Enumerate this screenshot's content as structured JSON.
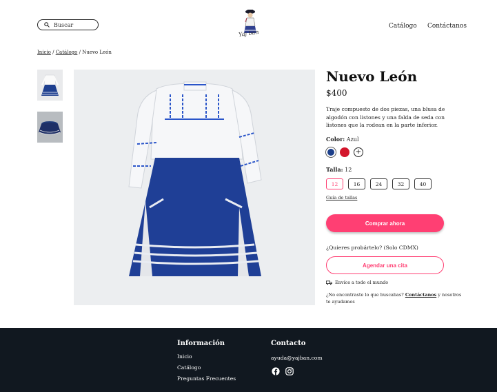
{
  "header": {
    "search_placeholder": "Buscar",
    "logo_text": "Yaj ban",
    "nav": [
      "Catálogo",
      "Contáctanos"
    ]
  },
  "breadcrumb": {
    "home": "Inicio",
    "sep": " / ",
    "catalog": "Catálogo",
    "current": "Nuevo León"
  },
  "product": {
    "title": "Nuevo León",
    "price": "$400",
    "description": "Traje compuesto de dos piezas, una blusa de algodón con listones y una falda  de seda con listones que la rodean en la parte inferior.",
    "color_label": "Color:",
    "color_value": "Azul",
    "colors": [
      "#1c3f8a",
      "#d3162c"
    ],
    "size_label": "Talla:",
    "size_value": "12",
    "sizes": [
      "12",
      "16",
      "24",
      "32",
      "40"
    ],
    "size_guide": "Guía de tallas",
    "buy_button": "Comprar ahora",
    "try_text": "¿Quieres probártelo?  (Solo CDMX)",
    "appointment_button": "Agendar una cita",
    "shipping": "Envíos a todo el mundo",
    "not_found_pre": "¿No encontraste lo que buscabas? ",
    "not_found_link": "Contáctanos",
    "not_found_post": " y nosotros te ayudamos"
  },
  "footer": {
    "info_title": "Información",
    "info_links": [
      "Inicio",
      "Catálogo",
      "Preguntas Frecuentes"
    ],
    "contact_title": "Contacto",
    "email": "ayuda@yajban.com",
    "social_icons": [
      "facebook-icon",
      "instagram-icon"
    ]
  },
  "colors": {
    "accent": "#ff3f73",
    "footer_bg": "#111820"
  }
}
